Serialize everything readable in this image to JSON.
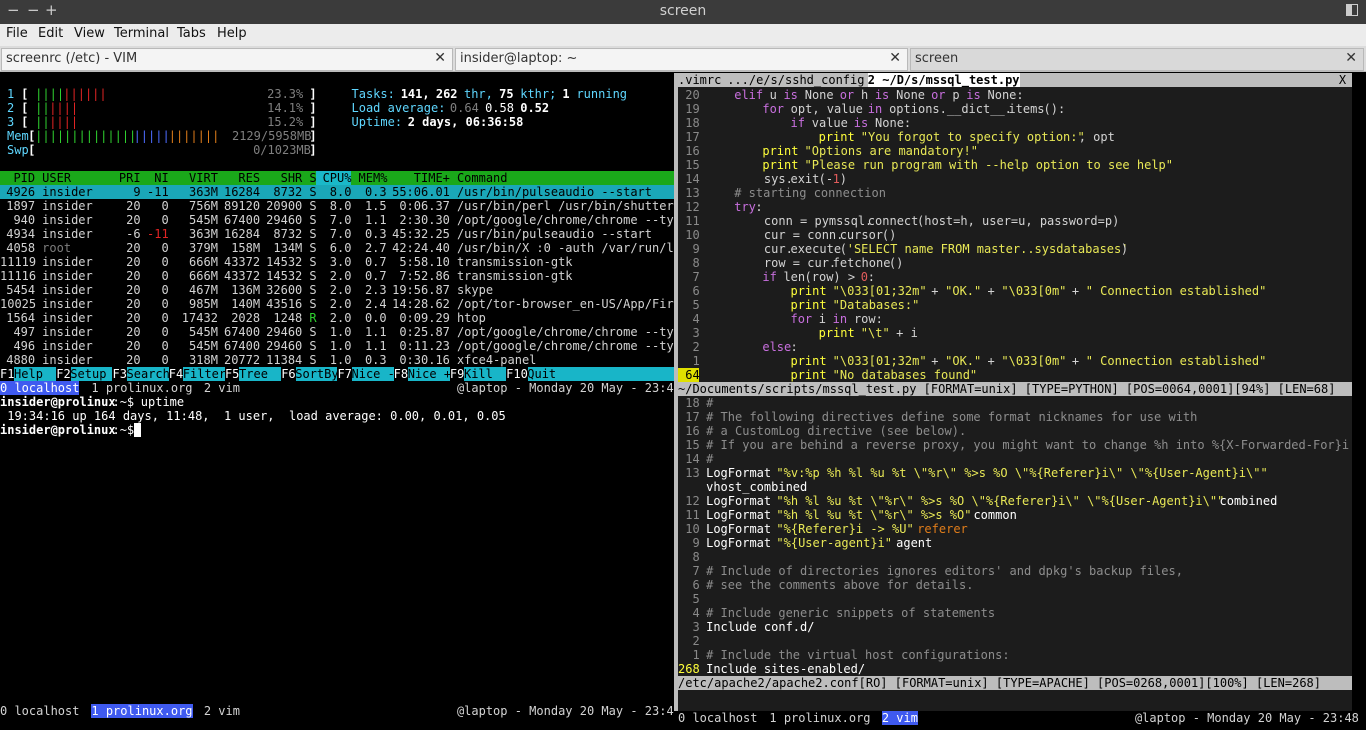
{
  "window": {
    "title": "screen",
    "controls": [
      "−",
      "−",
      "+"
    ]
  },
  "menu": [
    "File",
    "Edit",
    "View",
    "Terminal",
    "Tabs",
    "Help"
  ],
  "tabs": [
    {
      "label": "screenrc (/etc) - VIM",
      "close": "✕"
    },
    {
      "label": "insider@laptop: ~",
      "close": "✕"
    },
    {
      "label": "screen",
      "close": "✕"
    }
  ],
  "htop": {
    "cpu": [
      {
        "n": "1",
        "bar": "||||||||||",
        "pct": "23.3%"
      },
      {
        "n": "2",
        "bar": "||||||",
        "pct": "14.1%"
      },
      {
        "n": "3",
        "bar": "||||||",
        "pct": "15.2%"
      }
    ],
    "mem": {
      "label": "Mem",
      "bar": "||||||||||||||||||||||||||",
      "val": "2129/5958MB"
    },
    "swp": {
      "label": "Swp",
      "val": "0/1023MB"
    },
    "tasks": {
      "label": "Tasks:",
      "count": "141,",
      "thr": "262",
      "thr_lbl": "thr,",
      "kthr": "75",
      "kthr_lbl": "kthr;",
      "running": "1",
      "running_lbl": "running"
    },
    "load": {
      "label": "Load average:",
      "v1": "0.64",
      "v2": "0.58",
      "v3": "0.52"
    },
    "uptime": {
      "label": "Uptime:",
      "val": "2 days, 06:36:58"
    },
    "header": {
      "pid": "PID",
      "user": "USER",
      "pri": "PRI",
      "ni": "NI",
      "virt": "VIRT",
      "res": "RES",
      "shr": "SHR",
      "s": "S",
      "cpu": "CPU%",
      "mem": "MEM%",
      "time": "TIME+",
      "cmd": "Command"
    },
    "procs": [
      [
        "4926",
        "insider",
        "9",
        "-11",
        "363M",
        "16284",
        "8732",
        "S",
        "8.0",
        "0.3",
        "55:06.01",
        "/usr/bin/pulseaudio --start"
      ],
      [
        "1897",
        "insider",
        "20",
        "0",
        "756M",
        "89120",
        "20900",
        "S",
        "8.0",
        "1.5",
        "0:06.37",
        "/usr/bin/perl /usr/bin/shutter --"
      ],
      [
        "940",
        "insider",
        "20",
        "0",
        "545M",
        "67400",
        "29460",
        "S",
        "7.0",
        "1.1",
        "2:30.30",
        "/opt/google/chrome/chrome --type="
      ],
      [
        "4934",
        "insider",
        "-6",
        "-11",
        "363M",
        "16284",
        "8732",
        "S",
        "7.0",
        "0.3",
        "45:32.25",
        "/usr/bin/pulseaudio --start"
      ],
      [
        "4058",
        "root",
        "20",
        "0",
        "379M",
        "158M",
        "134M",
        "S",
        "6.0",
        "2.7",
        "42:24.40",
        "/usr/bin/X :0 -auth /var/run/ligh"
      ],
      [
        "11119",
        "insider",
        "20",
        "0",
        "666M",
        "43372",
        "14532",
        "S",
        "3.0",
        "0.7",
        "5:58.10",
        "transmission-gtk"
      ],
      [
        "11116",
        "insider",
        "20",
        "0",
        "666M",
        "43372",
        "14532",
        "S",
        "2.0",
        "0.7",
        "7:52.86",
        "transmission-gtk"
      ],
      [
        "5454",
        "insider",
        "20",
        "0",
        "467M",
        "136M",
        "32600",
        "S",
        "2.0",
        "2.3",
        "19:56.87",
        "skype"
      ],
      [
        "10025",
        "insider",
        "20",
        "0",
        "985M",
        "140M",
        "43516",
        "S",
        "2.0",
        "2.4",
        "14:28.62",
        "/opt/tor-browser_en-US/App/Firefo"
      ],
      [
        "1564",
        "insider",
        "20",
        "0",
        "17432",
        "2028",
        "1248",
        "R",
        "2.0",
        "0.0",
        "0:09.29",
        "htop"
      ],
      [
        "497",
        "insider",
        "20",
        "0",
        "545M",
        "67400",
        "29460",
        "S",
        "1.0",
        "1.1",
        "0:25.87",
        "/opt/google/chrome/chrome --type="
      ],
      [
        "496",
        "insider",
        "20",
        "0",
        "545M",
        "67400",
        "29460",
        "S",
        "1.0",
        "1.1",
        "0:11.23",
        "/opt/google/chrome/chrome --type="
      ],
      [
        "4880",
        "insider",
        "20",
        "0",
        "318M",
        "20772",
        "11384",
        "S",
        "1.0",
        "0.3",
        "0:30.16",
        "xfce4-panel"
      ]
    ],
    "fkeys": [
      [
        "F1",
        "Help"
      ],
      [
        "F2",
        "Setup"
      ],
      [
        "F3",
        "Search"
      ],
      [
        "F4",
        "Filter"
      ],
      [
        "F5",
        "Tree"
      ],
      [
        "F6",
        "SortBy"
      ],
      [
        "F7",
        "Nice -"
      ],
      [
        "F8",
        "Nice +"
      ],
      [
        "F9",
        "Kill"
      ],
      [
        "F10",
        "Quit"
      ]
    ]
  },
  "screen_status": {
    "w0": "0 localhost",
    "w1": "1 prolinux.org",
    "w2": "2 vim",
    "clock": "@laptop - Monday 20 May - 23:48"
  },
  "shell": {
    "prompt_user": "insider@prolinux",
    "prompt_path": ":~$",
    "cmd": " uptime",
    "output": " 19:34:16 up 164 days, 11:48,  1 user,  load average: 0.00, 0.01, 0.05"
  },
  "vim_top": {
    "tabs": [
      ".vimrc",
      ".../e/s/sshd_config",
      "2 ~/D/s/mssql_test.py"
    ],
    "close": "X",
    "lines": [
      {
        "n": "20",
        "t": "    elif u is None or h is None or p is None:"
      },
      {
        "n": "19",
        "t": "        for opt, value in options.__dict__.items():"
      },
      {
        "n": "18",
        "t": "            if value is None:"
      },
      {
        "n": "17",
        "t": "                print \"You forgot to specify option:\", opt"
      },
      {
        "n": "16",
        "t": "        print \"Options are mandatory!\""
      },
      {
        "n": "15",
        "t": "        print \"Please run program with --help option to see help\""
      },
      {
        "n": "14",
        "t": "        sys.exit(-1)"
      },
      {
        "n": "13",
        "t": "    # starting connection"
      },
      {
        "n": "12",
        "t": "    try:"
      },
      {
        "n": "11",
        "t": "        conn = pymssql.connect(host=h, user=u, password=p)"
      },
      {
        "n": "10",
        "t": "        cur = conn.cursor()"
      },
      {
        "n": "9",
        "t": "        cur.execute('SELECT name FROM master..sysdatabases')"
      },
      {
        "n": "8",
        "t": "        row = cur.fetchone()"
      },
      {
        "n": "7",
        "t": "        if len(row) > 0:"
      },
      {
        "n": "6",
        "t": "            print \"\\033[01;32m\" + \"OK.\" + \"\\033[0m\" + \" Connection established\""
      },
      {
        "n": "5",
        "t": "            print \"Databases:\""
      },
      {
        "n": "4",
        "t": "            for i in row:"
      },
      {
        "n": "3",
        "t": "                print \"\\t\" + i"
      },
      {
        "n": "2",
        "t": "        else:"
      },
      {
        "n": "1",
        "t": "            print \"\\033[01;32m\" + \"OK.\" + \"\\033[0m\" + \" Connection established\""
      },
      {
        "n": "64",
        "t": "            print \"No databases found\""
      }
    ],
    "status": "~/Documents/scripts/mssql_test.py [FORMAT=unix] [TYPE=PYTHON] [POS=0064,0001][94%] [LEN=68]"
  },
  "vim_bottom": {
    "lines": [
      {
        "n": "18",
        "t": "#"
      },
      {
        "n": "17",
        "t": "# The following directives define some format nicknames for use with"
      },
      {
        "n": "16",
        "t": "# a CustomLog directive (see below)."
      },
      {
        "n": "15",
        "t": "# If you are behind a reverse proxy, you might want to change %h into %{X-Forwarded-For}i"
      },
      {
        "n": "14",
        "t": "#"
      },
      {
        "n": "13",
        "t": "LogFormat \"%v:%p %h %l %u %t \\\"%r\\\" %>s %O \\\"%{Referer}i\\\" \\\"%{User-Agent}i\\\"\""
      },
      {
        "n": "",
        "t": "vhost_combined"
      },
      {
        "n": "12",
        "t": "LogFormat \"%h %l %u %t \\\"%r\\\" %>s %O \\\"%{Referer}i\\\" \\\"%{User-Agent}i\\\"\" combined"
      },
      {
        "n": "11",
        "t": "LogFormat \"%h %l %u %t \\\"%r\\\" %>s %O\" common"
      },
      {
        "n": "10",
        "t": "LogFormat \"%{Referer}i -> %U\" referer"
      },
      {
        "n": "9",
        "t": "LogFormat \"%{User-agent}i\" agent"
      },
      {
        "n": "8",
        "t": ""
      },
      {
        "n": "7",
        "t": "# Include of directories ignores editors' and dpkg's backup files,"
      },
      {
        "n": "6",
        "t": "# see the comments above for details."
      },
      {
        "n": "5",
        "t": ""
      },
      {
        "n": "4",
        "t": "# Include generic snippets of statements"
      },
      {
        "n": "3",
        "t": "Include conf.d/"
      },
      {
        "n": "2",
        "t": ""
      },
      {
        "n": "1",
        "t": "# Include the virtual host configurations:"
      },
      {
        "n": "268",
        "t": "Include sites-enabled/"
      }
    ],
    "status": "/etc/apache2/apache2.conf[RO] [FORMAT=unix] [TYPE=APACHE] [POS=0268,0001][100%] [LEN=268]"
  }
}
